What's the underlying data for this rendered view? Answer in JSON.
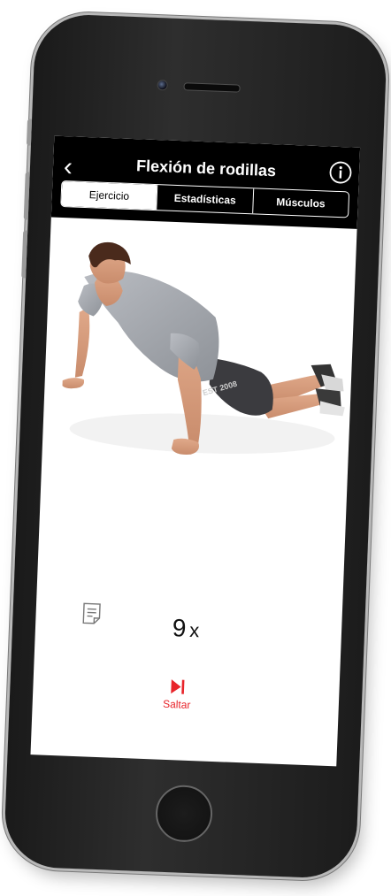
{
  "header": {
    "back_icon": "chevron-left",
    "title": "Flexión de rodillas",
    "info_icon": "info-circle"
  },
  "tabs": [
    {
      "label": "Ejercicio",
      "active": true
    },
    {
      "label": "Estadísticas",
      "active": false
    },
    {
      "label": "Músculos",
      "active": false
    }
  ],
  "exercise": {
    "shirt_print": "EST 2008",
    "reps_value": "9",
    "reps_unit": "x",
    "notes_icon": "notes-icon"
  },
  "skip": {
    "label": "Saltar",
    "icon": "skip-forward",
    "color": "#e8242a"
  }
}
